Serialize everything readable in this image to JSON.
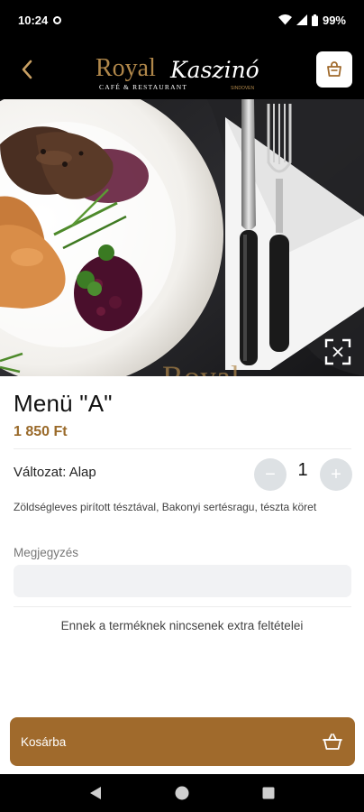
{
  "status_bar": {
    "time": "10:24",
    "battery": "99%"
  },
  "header": {
    "logo_text_left": "Royal",
    "logo_text_right": "Kaszinó",
    "logo_subtitle": "CAFÉ & RESTAURANT",
    "logo_tag": "SINDOVEN"
  },
  "product": {
    "title": "Menü \"A\"",
    "price": "1 850 Ft",
    "variant_label": "Változat:",
    "variant_value": "Alap",
    "quantity": "1",
    "description": "Zöldségleves pirított tésztával, Bakonyi sertésragu, tészta köret"
  },
  "note": {
    "label": "Megjegyzés",
    "placeholder": "",
    "value": ""
  },
  "extras": {
    "message": "Ennek a terméknek nincsenek extra feltételei"
  },
  "cart_button": {
    "label": "Kosárba"
  },
  "icons": {
    "back": "chevron-left-icon",
    "cart": "shopping-bag-icon",
    "expand": "fullscreen-icon",
    "basket": "basket-icon",
    "nav_back": "triangle-back-icon",
    "nav_home": "circle-home-icon",
    "nav_recents": "square-recents-icon"
  },
  "colors": {
    "accent": "#a06a2c",
    "price": "#9a6a2a",
    "header_bg": "#000000"
  }
}
